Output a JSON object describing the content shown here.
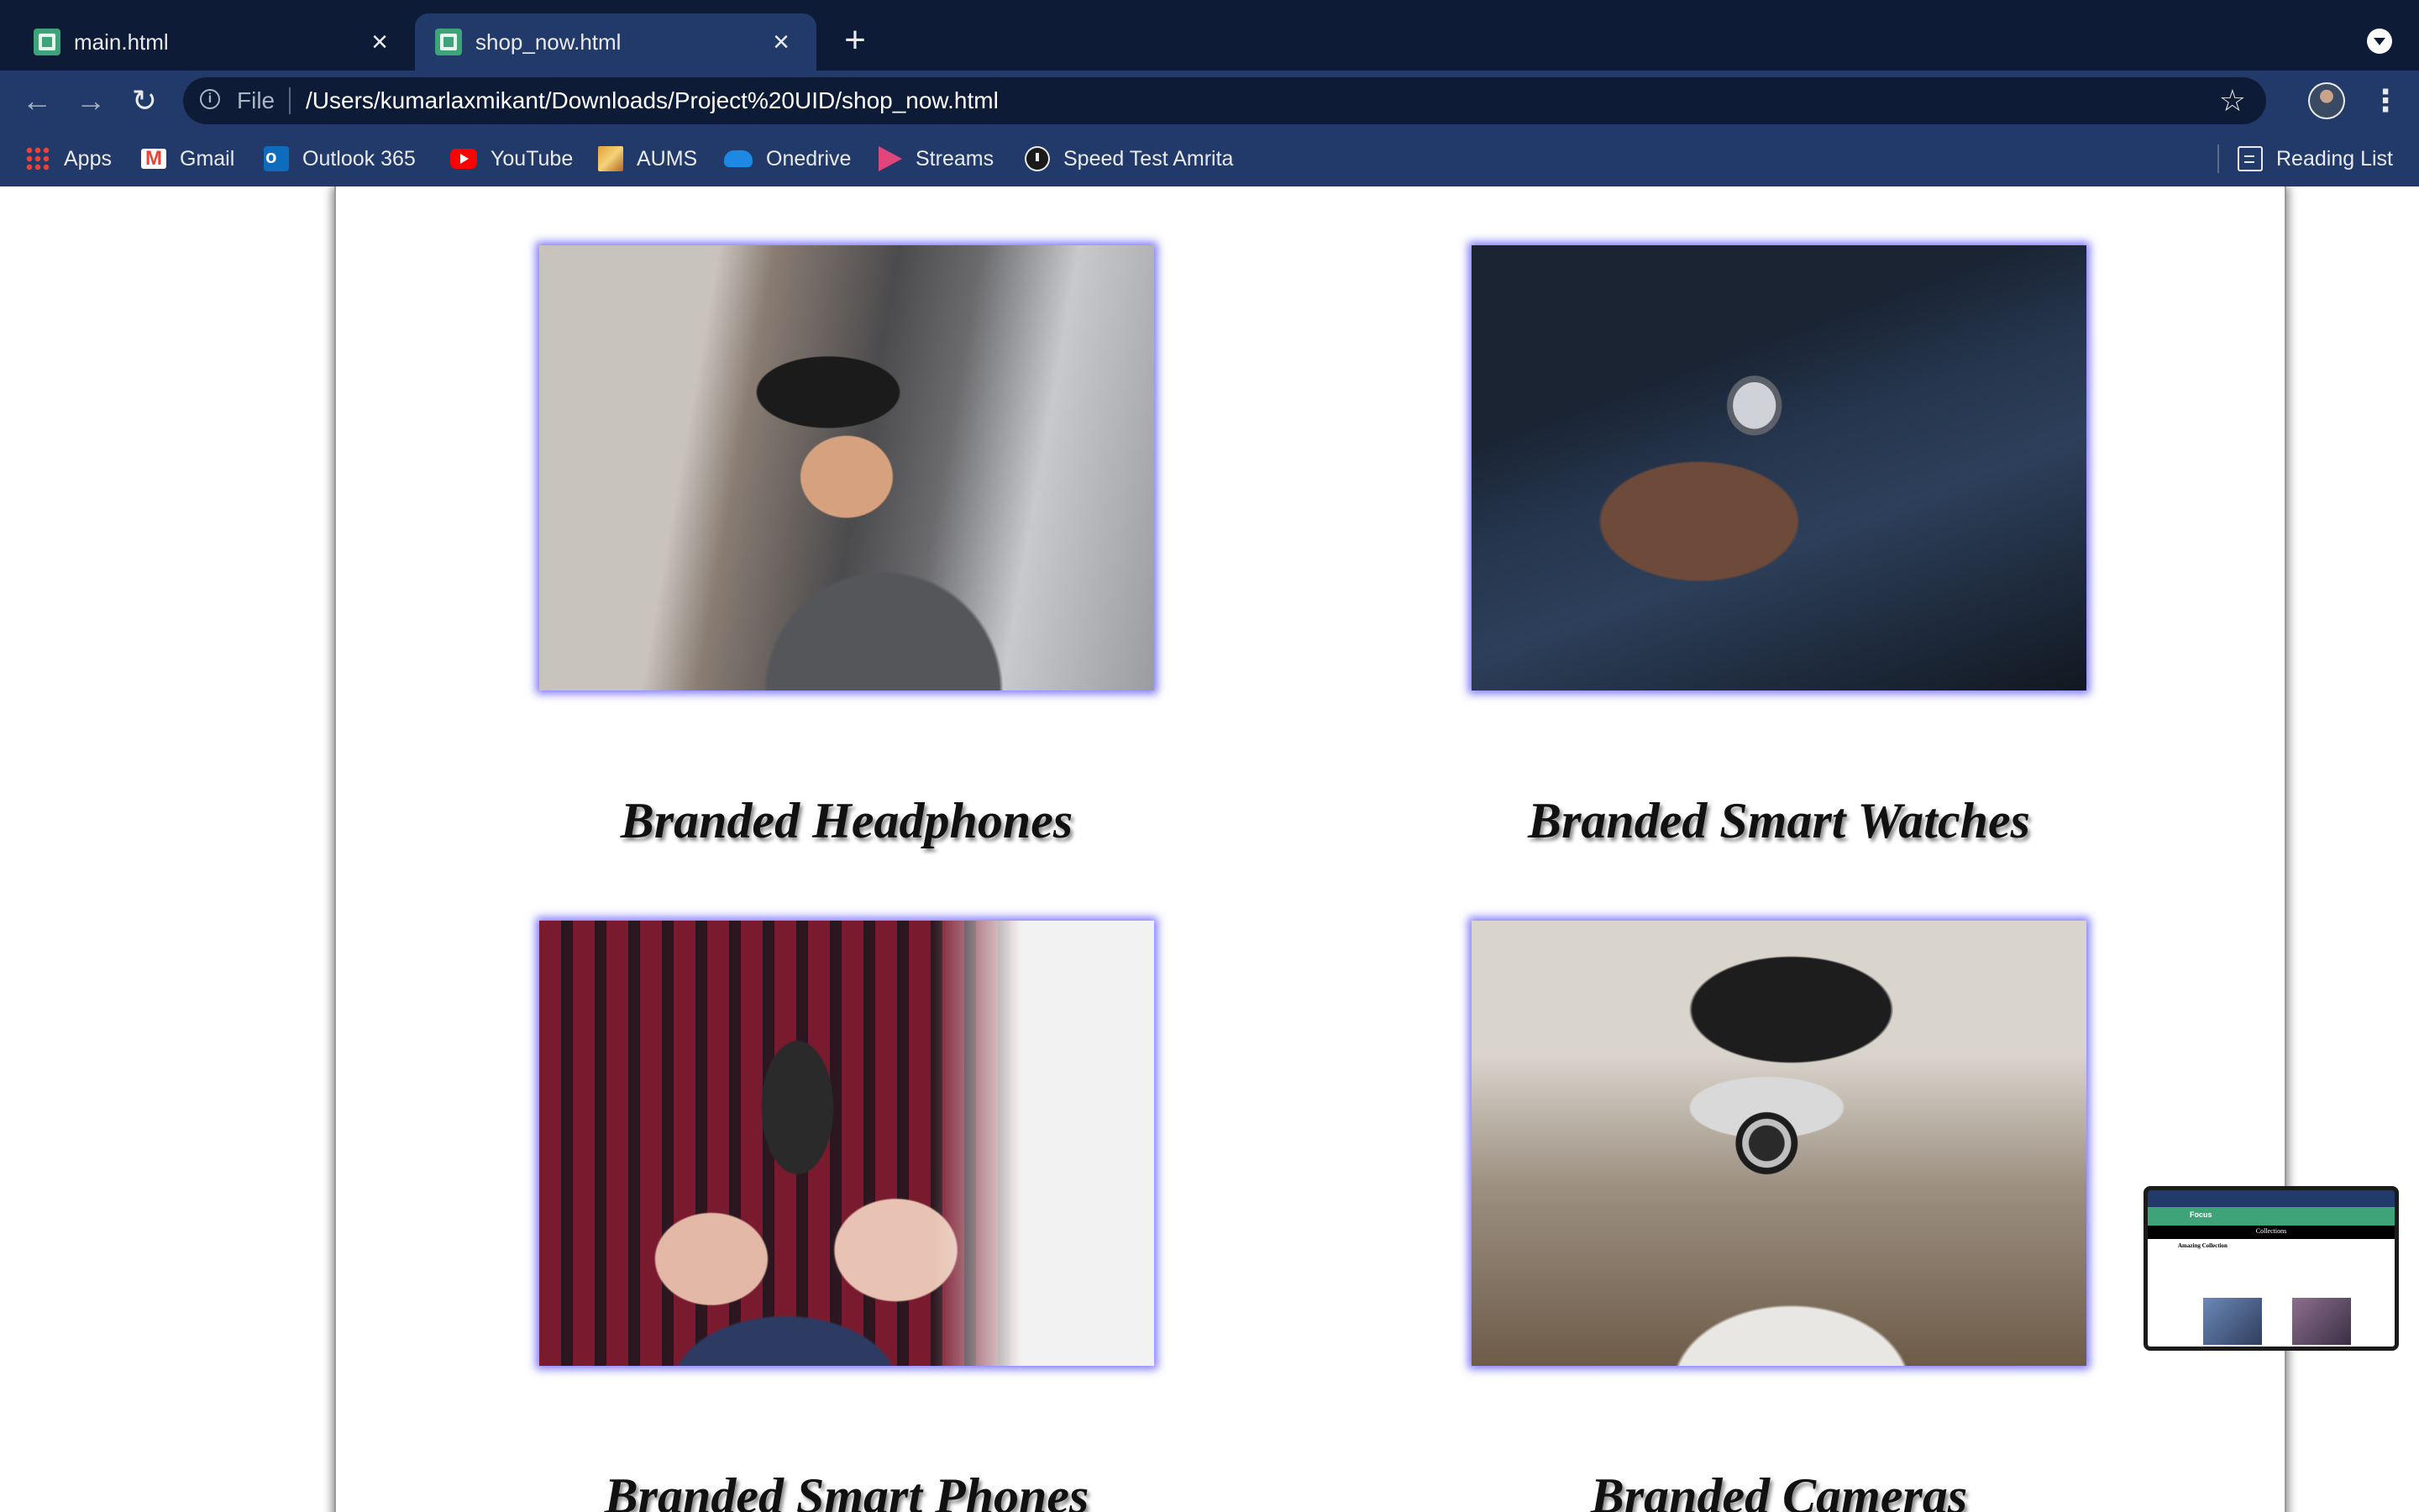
{
  "browser": {
    "tabs": [
      {
        "title": "main.html",
        "active": false
      },
      {
        "title": "shop_now.html",
        "active": true
      }
    ],
    "address": {
      "scheme_label": "File",
      "url": "/Users/kumarlaxmikant/Downloads/Project%20UID/shop_now.html"
    },
    "bookmarks": [
      {
        "label": "Apps",
        "icon": "apps-grid-icon"
      },
      {
        "label": "Gmail",
        "icon": "gmail-icon"
      },
      {
        "label": "Outlook 365",
        "icon": "outlook-icon"
      },
      {
        "label": "YouTube",
        "icon": "youtube-icon"
      },
      {
        "label": "AUMS",
        "icon": "aums-icon"
      },
      {
        "label": "Onedrive",
        "icon": "onedrive-icon"
      },
      {
        "label": "Streams",
        "icon": "streams-icon"
      },
      {
        "label": "Speed Test Amrita",
        "icon": "speed-test-icon"
      }
    ],
    "reading_list": "Reading List"
  },
  "products": [
    {
      "title": "Branded Headphones",
      "image": "headphones-photo"
    },
    {
      "title": "Branded Smart Watches",
      "image": "smart-watch-photo"
    },
    {
      "title": "Branded Smart Phones",
      "image": "smart-phone-photo"
    },
    {
      "title": "Branded Cameras",
      "image": "camera-photo"
    }
  ],
  "pip_preview": {
    "brand": "Focus",
    "bar_title": "Collections",
    "heading": "Amazing Collection"
  },
  "colors": {
    "tabstrip": "#0d1b36",
    "toolbar": "#213a6a",
    "image_glow": "#695fff",
    "title_text": "#111111"
  }
}
